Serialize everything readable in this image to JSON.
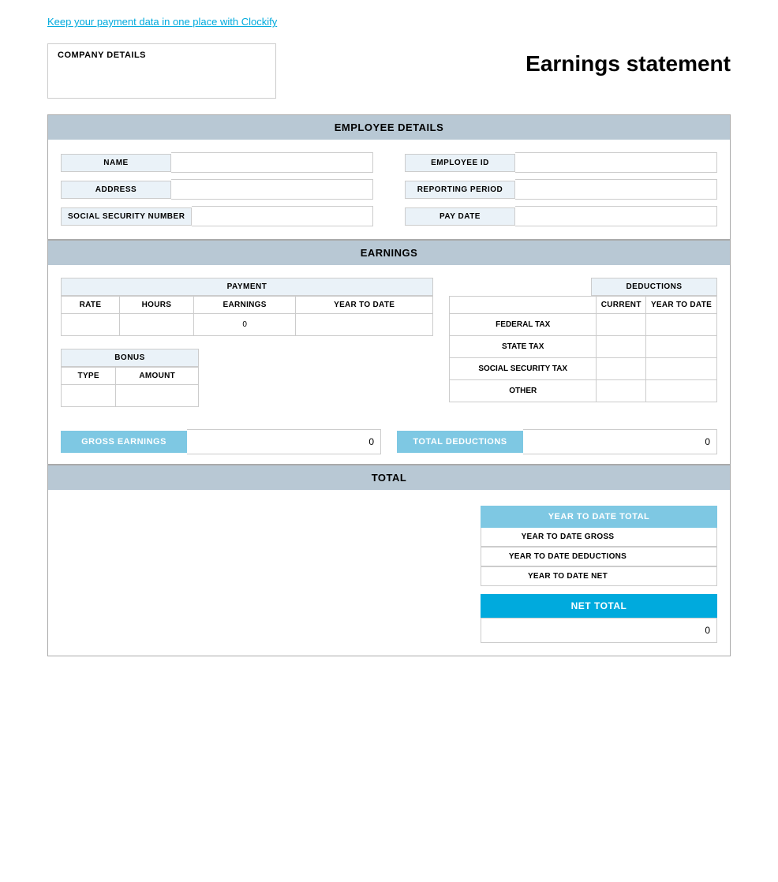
{
  "top_link": {
    "text": "Keep your payment data in one place with Clockify"
  },
  "header": {
    "company_label": "COMPANY DETAILS",
    "title": "Earnings statement"
  },
  "employee_section": {
    "title": "EMPLOYEE DETAILS",
    "fields_left": [
      {
        "label": "NAME",
        "value": ""
      },
      {
        "label": "ADDRESS",
        "value": ""
      },
      {
        "label": "SOCIAL SECURITY NUMBER",
        "value": ""
      }
    ],
    "fields_right": [
      {
        "label": "EMPLOYEE ID",
        "value": ""
      },
      {
        "label": "REPORTING PERIOD",
        "value": ""
      },
      {
        "label": "PAY DATE",
        "value": ""
      }
    ]
  },
  "earnings_section": {
    "title": "EARNINGS",
    "payment": {
      "label": "PAYMENT",
      "columns": [
        "RATE",
        "HOURS",
        "EARNINGS",
        "YEAR TO DATE"
      ],
      "row": {
        "rate": "",
        "hours": "",
        "earnings": "0",
        "ytd": ""
      }
    },
    "bonus": {
      "label": "BONUS",
      "columns": [
        "TYPE",
        "AMOUNT"
      ],
      "row": {
        "type": "",
        "amount": ""
      }
    },
    "deductions": {
      "label": "DEDUCTIONS",
      "col_current": "CURRENT",
      "col_ytd": "YEAR TO DATE",
      "rows": [
        {
          "label": "FEDERAL TAX",
          "current": "",
          "ytd": ""
        },
        {
          "label": "STATE TAX",
          "current": "",
          "ytd": ""
        },
        {
          "label": "SOCIAL SECURITY TAX",
          "current": "",
          "ytd": ""
        },
        {
          "label": "OTHER",
          "current": "",
          "ytd": ""
        }
      ]
    },
    "gross_earnings": {
      "label": "GROSS EARNINGS",
      "value": "0"
    },
    "total_deductions": {
      "label": "TOTAL DEDUCTIONS",
      "value": "0"
    }
  },
  "total_section": {
    "title": "TOTAL",
    "ytd_total_label": "YEAR TO DATE TOTAL",
    "rows": [
      {
        "label": "YEAR TO DATE GROSS",
        "value": ""
      },
      {
        "label": "YEAR TO DATE DEDUCTIONS",
        "value": ""
      },
      {
        "label": "YEAR TO DATE NET",
        "value": ""
      }
    ],
    "net_total_label": "NET TOTAL",
    "net_total_value": "0"
  }
}
